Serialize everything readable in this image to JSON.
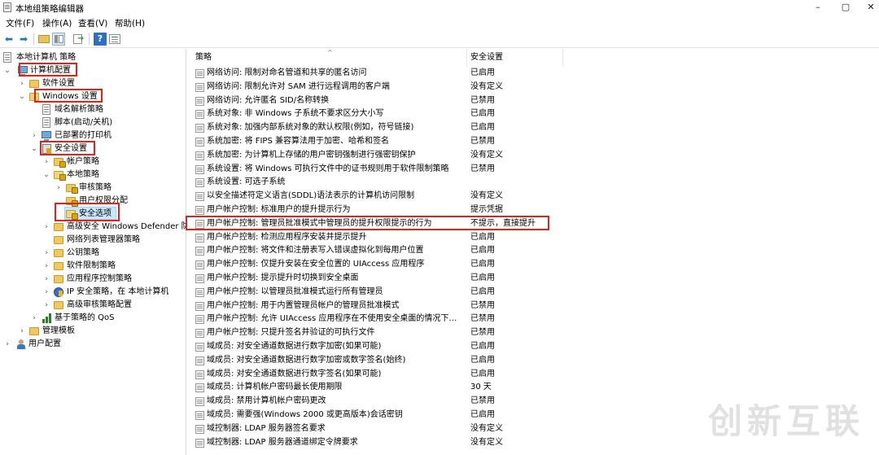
{
  "window": {
    "title": "本地组策略编辑器",
    "controls": {
      "minimize": "–",
      "maximize": "▢",
      "close": "✕"
    }
  },
  "menu": [
    "文件(F)",
    "操作(A)",
    "查看(V)",
    "帮助(H)"
  ],
  "toolbar": {
    "icons": [
      "back-icon",
      "forward-icon",
      "up-folder-icon",
      "show-tree-icon",
      "export-list-icon",
      "help-icon",
      "properties-icon"
    ],
    "back": "⬅",
    "forward": "➡",
    "help": "?"
  },
  "tree": {
    "root": "本地计算机 策略",
    "items": [
      {
        "label": "计算机配置",
        "expander": "⌄",
        "highlighted": true
      },
      {
        "label": "软件设置",
        "expander": "›"
      },
      {
        "label": "Windows 设置",
        "expander": "⌄",
        "highlighted": true
      },
      {
        "label": "域名解析策略",
        "expander": ""
      },
      {
        "label": "脚本(启动/关机)",
        "expander": ""
      },
      {
        "label": "已部署的打印机",
        "expander": "›"
      },
      {
        "label": "安全设置",
        "expander": "⌄",
        "highlighted": true
      },
      {
        "label": "帐户策略",
        "expander": "›"
      },
      {
        "label": "本地策略",
        "expander": "⌄"
      },
      {
        "label": "审核策略",
        "expander": "›"
      },
      {
        "label": "用户权限分配",
        "expander": ""
      },
      {
        "label": "安全选项",
        "expander": "",
        "selected": true,
        "highlighted": true
      },
      {
        "label": "高级安全 Windows Defender 防",
        "expander": "›"
      },
      {
        "label": "网络列表管理器策略",
        "expander": ""
      },
      {
        "label": "公钥策略",
        "expander": "›"
      },
      {
        "label": "软件限制策略",
        "expander": "›"
      },
      {
        "label": "应用程序控制策略",
        "expander": "›"
      },
      {
        "label": "IP 安全策略，在 本地计算机",
        "expander": "›"
      },
      {
        "label": "高级审核策略配置",
        "expander": "›"
      },
      {
        "label": "基于策略的 QoS",
        "expander": "›"
      },
      {
        "label": "管理模板",
        "expander": "›"
      },
      {
        "label": "用户配置",
        "expander": "›"
      }
    ]
  },
  "list": {
    "columns": {
      "policy": "策略",
      "setting": "安全设置"
    },
    "rows": [
      {
        "policy": "网络访问: 限制对命名管道和共享的匿名访问",
        "setting": "已启用"
      },
      {
        "policy": "网络访问: 限制允许对 SAM 进行远程调用的客户端",
        "setting": "没有定义"
      },
      {
        "policy": "网络访问: 允许匿名 SID/名称转换",
        "setting": "已禁用"
      },
      {
        "policy": "系统对象: 非 Windows 子系统不要求区分大小写",
        "setting": "已启用"
      },
      {
        "policy": "系统对象: 加强内部系统对象的默认权限(例如，符号链接)",
        "setting": "已启用"
      },
      {
        "policy": "系统加密: 将 FIPS 兼容算法用于加密、哈希和签名",
        "setting": "已禁用"
      },
      {
        "policy": "系统加密: 为计算机上存储的用户密钥强制进行强密钥保护",
        "setting": "没有定义"
      },
      {
        "policy": "系统设置: 将 Windows 可执行文件中的证书规则用于软件限制策略",
        "setting": "已禁用"
      },
      {
        "policy": "系统设置: 可选子系统",
        "setting": ""
      },
      {
        "policy": "以安全描述符定义语言(SDDL)语法表示的计算机访问限制",
        "setting": "没有定义"
      },
      {
        "policy": "用户帐户控制: 标准用户的提升提示行为",
        "setting": "提示凭据"
      },
      {
        "policy": "用户帐户控制: 管理员批准模式中管理员的提升权限提示的行为",
        "setting": "不提示，直接提升",
        "highlighted": true
      },
      {
        "policy": "用户帐户控制: 检测应用程序安装并提示提升",
        "setting": "已启用"
      },
      {
        "policy": "用户帐户控制: 将文件和注册表写入错误虚拟化到每用户位置",
        "setting": "已启用"
      },
      {
        "policy": "用户帐户控制: 仅提升安装在安全位置的 UIAccess 应用程序",
        "setting": "已启用"
      },
      {
        "policy": "用户帐户控制: 提示提升时切换到安全桌面",
        "setting": "已启用"
      },
      {
        "policy": "用户帐户控制: 以管理员批准模式运行所有管理员",
        "setting": "已启用"
      },
      {
        "policy": "用户帐户控制: 用于内置管理员帐户的管理员批准模式",
        "setting": "已禁用"
      },
      {
        "policy": "用户帐户控制: 允许 UIAccess 应用程序在不使用安全桌面的情况下提升...",
        "setting": "已禁用"
      },
      {
        "policy": "用户帐户控制: 只提升签名并验证的可执行文件",
        "setting": "已禁用"
      },
      {
        "policy": "域成员: 对安全通道数据进行数字加密(如果可能)",
        "setting": "已启用"
      },
      {
        "policy": "域成员: 对安全通道数据进行数字加密或数字签名(始终)",
        "setting": "已启用"
      },
      {
        "policy": "域成员: 对安全通道数据进行数字签名(如果可能)",
        "setting": "已启用"
      },
      {
        "policy": "域成员: 计算机帐户密码最长使用期限",
        "setting": "30 天"
      },
      {
        "policy": "域成员: 禁用计算机帐户密码更改",
        "setting": "已禁用"
      },
      {
        "policy": "域成员: 需要强(Windows 2000 或更高版本)会话密钥",
        "setting": "已启用"
      },
      {
        "policy": "域控制器: LDAP 服务器签名要求",
        "setting": "没有定义"
      },
      {
        "policy": "域控制器: LDAP 服务器通道绑定令牌要求",
        "setting": "没有定义"
      }
    ]
  },
  "watermark": "创新互联"
}
